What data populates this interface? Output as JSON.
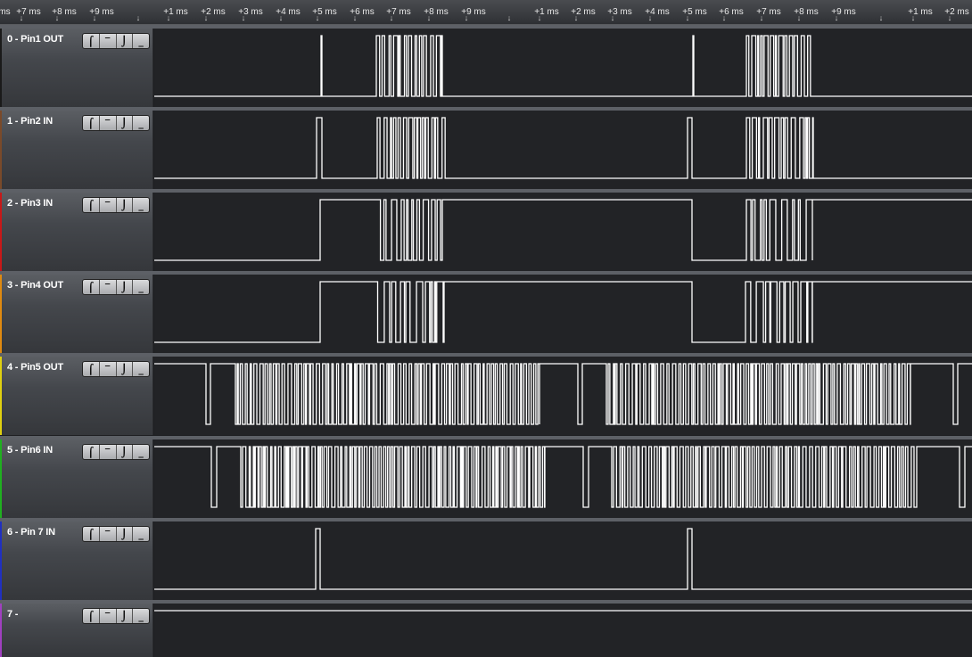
{
  "ruler": {
    "ticks": [
      "+7 ms",
      "+8 ms",
      "+9 ms",
      "+1 ms",
      "+2 ms",
      "+3 ms",
      "+4 ms",
      "+5 ms",
      "+6 ms",
      "+7 ms",
      "+8 ms",
      "+9 ms",
      "+1 ms",
      "+2 ms",
      "+3 ms",
      "+4 ms",
      "+5 ms",
      "+6 ms",
      "+7 ms",
      "+8 ms",
      "+9 ms",
      "+1 ms",
      "+2 ms"
    ],
    "left_edge_label": "ms"
  },
  "channels": [
    {
      "label": "0 - Pin1 OUT",
      "color": "#1a1a1a"
    },
    {
      "label": "1 - Pin2 IN",
      "color": "#7a4a2a"
    },
    {
      "label": "2 - Pin3 IN",
      "color": "#c81818"
    },
    {
      "label": "3 - Pin4 OUT",
      "color": "#e08a10"
    },
    {
      "label": "4 - Pin5 OUT",
      "color": "#e0d010"
    },
    {
      "label": "5 - Pin6 IN",
      "color": "#20b020"
    },
    {
      "label": "6 - Pin 7 IN",
      "color": "#2030c0"
    },
    {
      "label": "7 -",
      "color": "#a040c0"
    }
  ],
  "trigger_buttons": {
    "rising": "⌠",
    "high": "‾",
    "falling": "⌡",
    "low": "_"
  },
  "colors": {
    "waveform": "#ffffff",
    "background": "#222326"
  }
}
